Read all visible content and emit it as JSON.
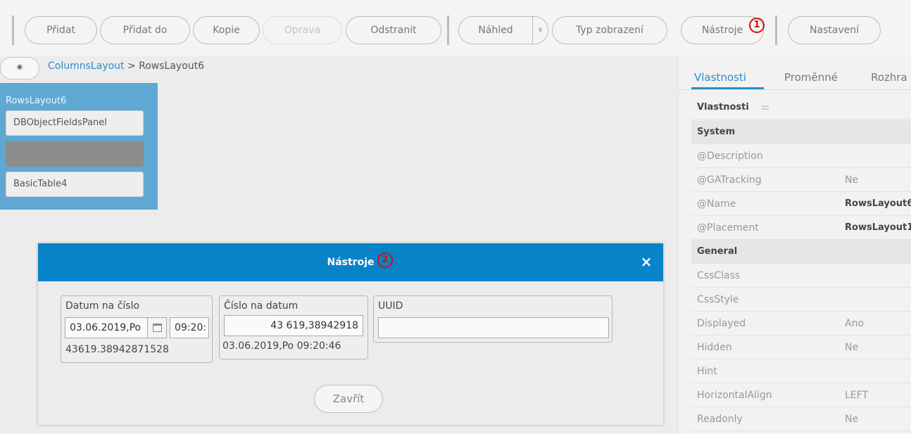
{
  "toolbar": {
    "pridat": "Přidat",
    "pridat_do": "Přidat do",
    "kopie": "Kopie",
    "oprava": "Oprava",
    "odstranit": "Odstranit",
    "nahled": "Náhled",
    "typ_zobrazeni": "Typ zobrazení",
    "nastroje": "Nástroje",
    "nastaveni": "Nastavení",
    "marker1": "1"
  },
  "breadcrumb": {
    "link": "ColumnsLayout",
    "separator": " > ",
    "current": "RowsLayout6"
  },
  "designer": {
    "title": "RowsLayout6",
    "items": [
      "DBObjectFieldsPanel",
      "",
      "BasicTable4"
    ]
  },
  "right_panel": {
    "tabs": [
      "Vlastnosti",
      "Proměnné",
      "Rozhra"
    ],
    "header": "Vlastnosti",
    "groups": {
      "system": "System",
      "general": "General"
    },
    "props": {
      "description": {
        "key": "@Description",
        "value": ""
      },
      "gatracking": {
        "key": "@GATracking",
        "value": "Ne"
      },
      "name": {
        "key": "@Name",
        "value": "RowsLayout6"
      },
      "placement": {
        "key": "@Placement",
        "value": "RowsLayout1"
      },
      "cssclass": {
        "key": "CssClass",
        "value": ""
      },
      "cssstyle": {
        "key": "CssStyle",
        "value": ""
      },
      "displayed": {
        "key": "Displayed",
        "value": "Ano"
      },
      "hidden": {
        "key": "Hidden",
        "value": "Ne"
      },
      "hint": {
        "key": "Hint",
        "value": ""
      },
      "halign": {
        "key": "HorizontalAlign",
        "value": "LEFT"
      },
      "readonly": {
        "key": "Readonly",
        "value": "Ne"
      }
    }
  },
  "dialog": {
    "title": "Nástroje",
    "marker": "2",
    "close_x": "×",
    "date_to_number": {
      "title": "Datum na číslo",
      "date_value": "03.06.2019,Po",
      "time_value": "09:20:",
      "result": "43619.38942871528"
    },
    "number_to_date": {
      "title": "Číslo na datum",
      "number_value": "43 619,38942918",
      "result": "03.06.2019,Po 09:20:46"
    },
    "uuid": {
      "title": "UUID",
      "value": ""
    },
    "close_button": "Zavřít"
  },
  "colors": {
    "accent": "#0883c8",
    "link": "#2a8fc8",
    "designer_bg": "#5fa8d3",
    "marker": "#d01010"
  }
}
